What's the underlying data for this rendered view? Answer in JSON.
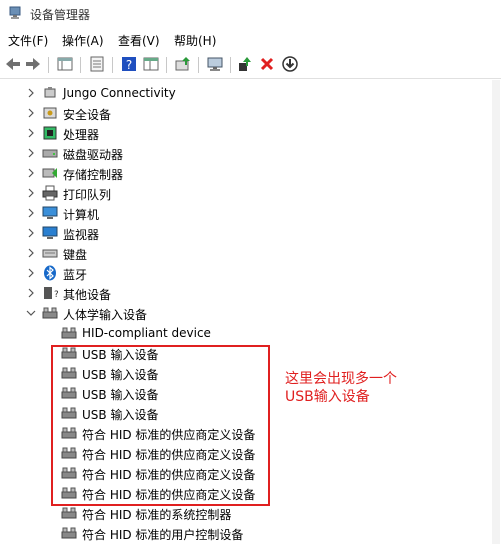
{
  "window": {
    "title": "设备管理器"
  },
  "menu": {
    "file": "文件(F)",
    "action": "操作(A)",
    "view": "查看(V)",
    "help": "帮助(H)"
  },
  "tree": {
    "categories": [
      {
        "label": "Jungo Connectivity"
      },
      {
        "label": "安全设备"
      },
      {
        "label": "处理器"
      },
      {
        "label": "磁盘驱动器"
      },
      {
        "label": "存储控制器"
      },
      {
        "label": "打印队列"
      },
      {
        "label": "计算机"
      },
      {
        "label": "监视器"
      },
      {
        "label": "键盘"
      },
      {
        "label": "蓝牙"
      },
      {
        "label": "其他设备"
      },
      {
        "label": "人体学输入设备"
      }
    ],
    "hid_children": [
      {
        "label": "HID-compliant device"
      },
      {
        "label": "USB 输入设备"
      },
      {
        "label": "USB 输入设备"
      },
      {
        "label": "USB 输入设备"
      },
      {
        "label": "USB 输入设备"
      },
      {
        "label": "符合 HID 标准的供应商定义设备"
      },
      {
        "label": "符合 HID 标准的供应商定义设备"
      },
      {
        "label": "符合 HID 标准的供应商定义设备"
      },
      {
        "label": "符合 HID 标准的供应商定义设备"
      },
      {
        "label": "符合 HID 标准的系统控制器"
      },
      {
        "label": "符合 HID 标准的用户控制设备"
      }
    ]
  },
  "annotation": {
    "line1": "这里会出现多一个",
    "line2": "USB输入设备"
  },
  "colors": {
    "annotation": "#e02020",
    "delete": "#e02020",
    "help": "#1f4fbf"
  },
  "icons": [
    "back-arrow-icon",
    "forward-arrow-icon",
    "properties-icon",
    "help-icon",
    "scan-hardware-icon",
    "update-driver-icon",
    "delete-x-icon",
    "download-icon"
  ]
}
